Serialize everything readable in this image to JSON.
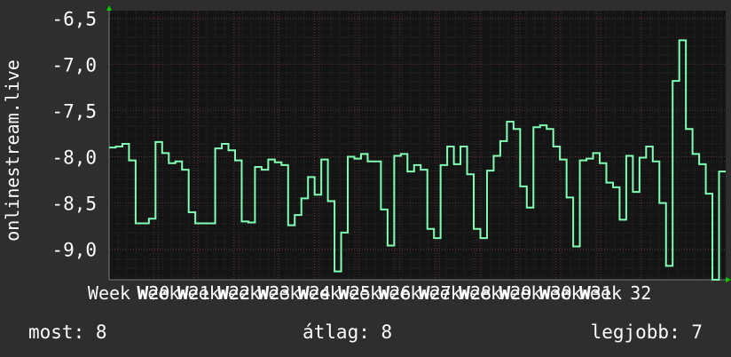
{
  "chart_data": {
    "type": "line",
    "ylabel": "onlinestream.live",
    "yticks": [
      "-6,5",
      "-7,0",
      "-7,5",
      "-8,0",
      "-8,5",
      "-9,0"
    ],
    "ylim": [
      -9.33,
      -6.42
    ],
    "xlim": [
      0,
      138
    ],
    "xticks": [
      {
        "label": "Week",
        "x": 0
      },
      {
        "label": "W20",
        "x": 10
      },
      {
        "label": "Week",
        "x": 11
      },
      {
        "label": "W21",
        "x": 19
      },
      {
        "label": "Week",
        "x": 20
      },
      {
        "label": "W22",
        "x": 28
      },
      {
        "label": "Week",
        "x": 29
      },
      {
        "label": "W23",
        "x": 37
      },
      {
        "label": "Week",
        "x": 38
      },
      {
        "label": "W24",
        "x": 46
      },
      {
        "label": "Week",
        "x": 47
      },
      {
        "label": "W25",
        "x": 55
      },
      {
        "label": "Week",
        "x": 56
      },
      {
        "label": "W26",
        "x": 64
      },
      {
        "label": "Week",
        "x": 65
      },
      {
        "label": "W27",
        "x": 73
      },
      {
        "label": "Week",
        "x": 74
      },
      {
        "label": "W28",
        "x": 82
      },
      {
        "label": "Week",
        "x": 83
      },
      {
        "label": "W29",
        "x": 91
      },
      {
        "label": "Week",
        "x": 92
      },
      {
        "label": "W30",
        "x": 100
      },
      {
        "label": "Week",
        "x": 101
      },
      {
        "label": "W31",
        "x": 109
      },
      {
        "label": "Week",
        "x": 110
      },
      {
        "label": "32",
        "x": 119
      }
    ],
    "grid": true,
    "legend": "none",
    "line_color": "#7fffb4",
    "series": [
      {
        "values": [
          -7.9,
          -7.89,
          -7.86,
          -8.04,
          -8.72,
          -8.72,
          -8.67,
          -7.84,
          -7.96,
          -8.07,
          -8.05,
          -8.14,
          -8.6,
          -8.72,
          -8.72,
          -8.72,
          -7.91,
          -7.86,
          -7.93,
          -8.04,
          -8.7,
          -8.71,
          -8.11,
          -8.14,
          -8.03,
          -8.06,
          -8.09,
          -8.74,
          -8.63,
          -8.45,
          -8.22,
          -8.41,
          -8.03,
          -8.48,
          -9.24,
          -8.82,
          -8.0,
          -8.02,
          -7.97,
          -8.05,
          -8.05,
          -8.57,
          -8.96,
          -7.99,
          -7.97,
          -8.16,
          -8.09,
          -8.14,
          -8.78,
          -8.88,
          -8.09,
          -7.89,
          -8.08,
          -7.89,
          -8.19,
          -8.78,
          -8.88,
          -8.15,
          -7.99,
          -7.83,
          -7.62,
          -7.7,
          -8.32,
          -8.55,
          -7.68,
          -7.66,
          -7.7,
          -7.89,
          -8.03,
          -8.44,
          -8.97,
          -8.04,
          -8.02,
          -7.96,
          -8.07,
          -8.28,
          -8.33,
          -8.68,
          -7.99,
          -8.38,
          -8.01,
          -7.89,
          -8.05,
          -8.5,
          -9.18,
          -7.18,
          -6.74,
          -7.7,
          -7.97,
          -8.08,
          -8.4,
          -9.33,
          -8.16
        ]
      }
    ]
  },
  "stats": {
    "now": "most: 8",
    "avg": "átlag: 8",
    "best": "legjobb: 7"
  },
  "colors": {
    "background": "#2e2e2e",
    "plot_background": "#141414",
    "grid_minor": "#2b2b2b",
    "grid_major": "#5a2f2f",
    "axis_arrow": "#00cc00",
    "text": "#ffffff"
  }
}
